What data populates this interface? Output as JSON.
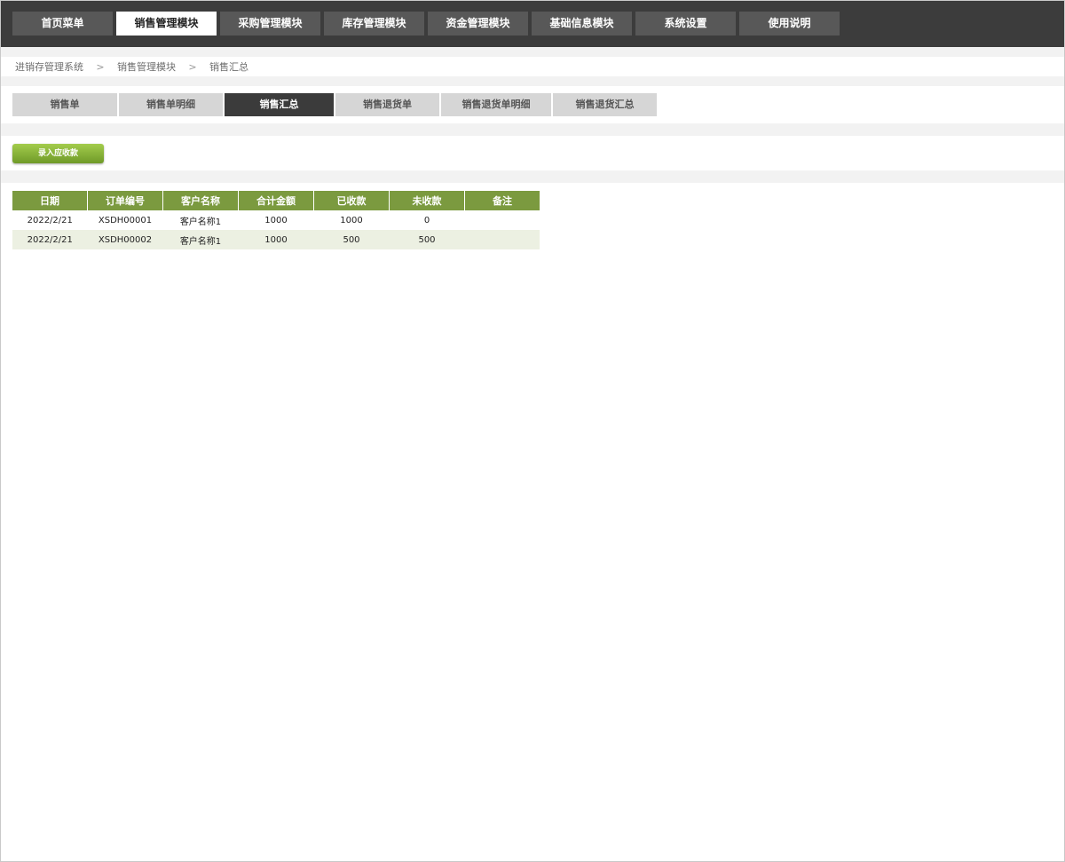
{
  "topnav": {
    "items": [
      {
        "label": "首页菜单"
      },
      {
        "label": "销售管理模块"
      },
      {
        "label": "采购管理模块"
      },
      {
        "label": "库存管理模块"
      },
      {
        "label": "资金管理模块"
      },
      {
        "label": "基础信息模块"
      },
      {
        "label": "系统设置"
      },
      {
        "label": "使用说明"
      }
    ],
    "active_index": 1
  },
  "breadcrumb": {
    "items": [
      "进销存管理系统",
      "销售管理模块",
      "销售汇总"
    ],
    "separator": ">"
  },
  "subtabs": {
    "items": [
      {
        "label": "销售单"
      },
      {
        "label": "销售单明细"
      },
      {
        "label": "销售汇总"
      },
      {
        "label": "销售退货单"
      },
      {
        "label": "销售退货单明细"
      },
      {
        "label": "销售退货汇总"
      }
    ],
    "active_index": 2
  },
  "actions": {
    "add_receivable_label": "录入应收款"
  },
  "table": {
    "headers": [
      "日期",
      "订单编号",
      "客户名称",
      "合计金额",
      "已收款",
      "未收款",
      "备注"
    ],
    "rows": [
      [
        "2022/2/21",
        "XSDH00001",
        "客户名称1",
        "1000",
        "1000",
        "0",
        ""
      ],
      [
        "2022/2/21",
        "XSDH00002",
        "客户名称1",
        "1000",
        "500",
        "500",
        ""
      ]
    ]
  },
  "colors": {
    "topbar_bg": "#3c3c3c",
    "header_green": "#7b9a3f",
    "button_green": "#8bb63a",
    "alt_row": "#ecf0e2"
  }
}
